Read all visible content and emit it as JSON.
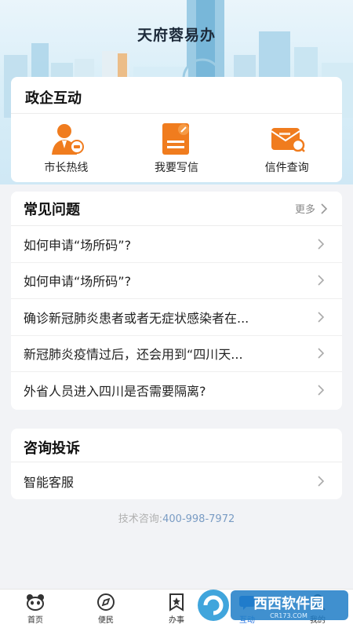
{
  "header": {
    "title": "天府蓉易办"
  },
  "interaction": {
    "title": "政企互动",
    "actions": [
      {
        "label": "市长热线",
        "icon": "mayor-hotline-icon"
      },
      {
        "label": "我要写信",
        "icon": "write-letter-icon"
      },
      {
        "label": "信件查询",
        "icon": "letter-query-icon"
      }
    ]
  },
  "faq": {
    "title": "常见问题",
    "more": "更多",
    "items": [
      "如何申请“场所码”?",
      "如何申请“场所码”?",
      "确诊新冠肺炎患者或者无症状感染者在...",
      "新冠肺炎疫情过后，还会用到“四川天...",
      "外省人员进入四川是否需要隔离?"
    ]
  },
  "complaint": {
    "title": "咨询投诉",
    "item": "智能客服"
  },
  "footer": {
    "label": "技术咨询:",
    "phone": "400-998-7972"
  },
  "tabbar": {
    "tabs": [
      {
        "label": "首页",
        "icon": "home-panda-icon"
      },
      {
        "label": "便民",
        "icon": "compass-icon"
      },
      {
        "label": "办事",
        "icon": "bookmark-star-icon"
      },
      {
        "label": "互动",
        "icon": "interaction-icon",
        "active": true
      },
      {
        "label": "我的",
        "icon": "profile-icon"
      }
    ]
  },
  "watermark": {
    "text": "西西软件园",
    "sub": "CR173.COM"
  },
  "colors": {
    "accent_orange": "#f07c1e",
    "tab_active": "#2b78e4",
    "phone": "#7a9cc4"
  }
}
